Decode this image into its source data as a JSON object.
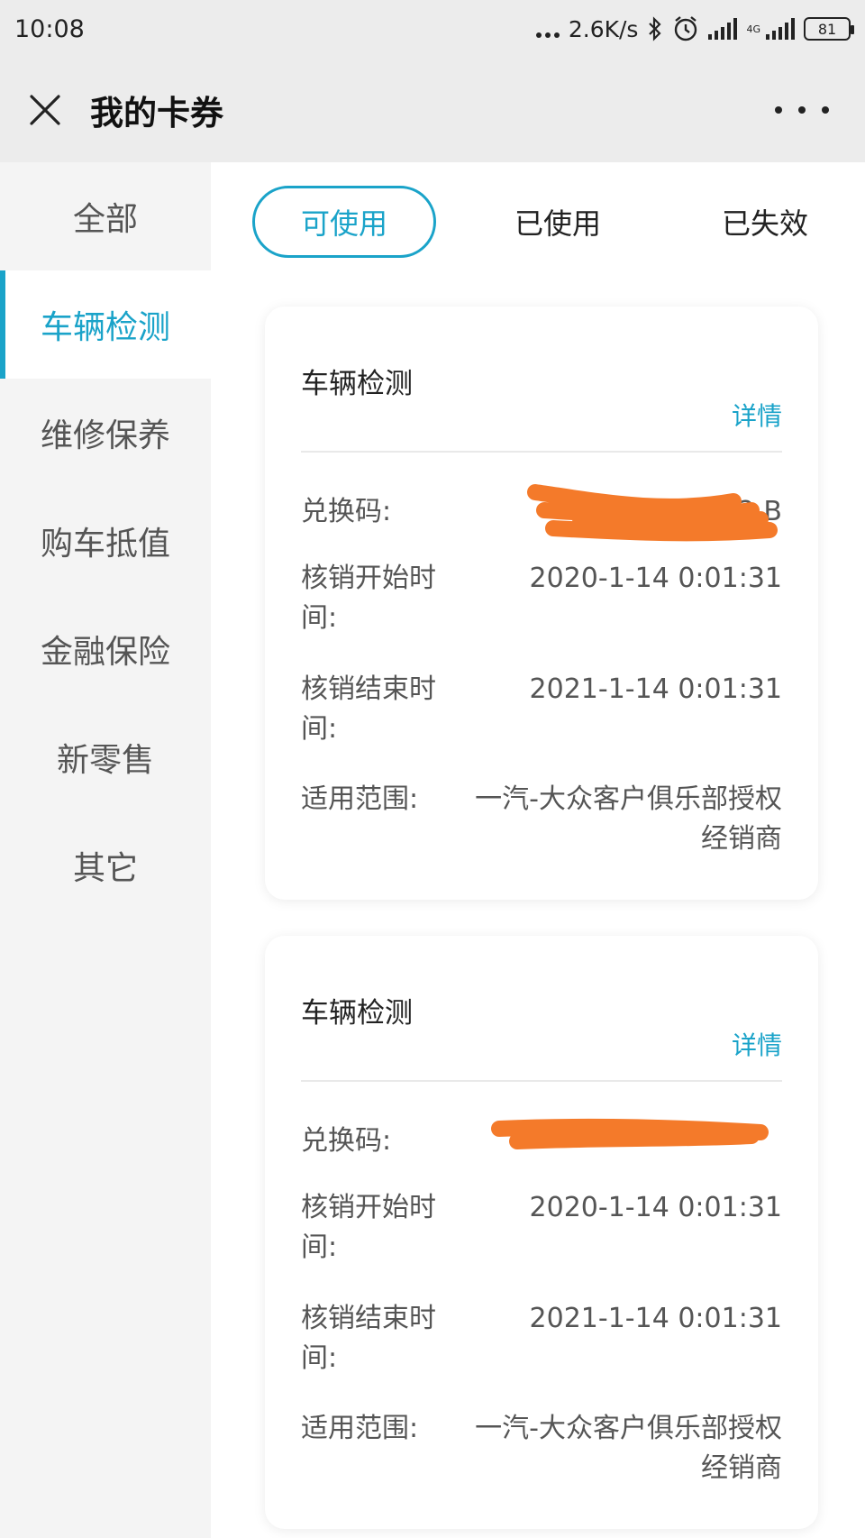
{
  "status_bar": {
    "time": "10:08",
    "net_speed": "2.6K/s",
    "network_type": "4G",
    "battery": "81"
  },
  "header": {
    "title": "我的卡券"
  },
  "sidebar": {
    "items": [
      {
        "label": "全部"
      },
      {
        "label": "车辆检测"
      },
      {
        "label": "维修保养"
      },
      {
        "label": "购车抵值"
      },
      {
        "label": "金融保险"
      },
      {
        "label": "新零售"
      },
      {
        "label": "其它"
      }
    ],
    "active_index": 1
  },
  "tabs": [
    {
      "label": "可使用"
    },
    {
      "label": "已使用"
    },
    {
      "label": "已失效"
    }
  ],
  "cards": [
    {
      "title": "车辆检测",
      "detail_label": "详情",
      "rows": [
        {
          "label": "兑换码:",
          "value": "2 B"
        },
        {
          "label": "核销开始时间:",
          "value": "2020-1-14 0:01:31"
        },
        {
          "label": "核销结束时间:",
          "value": "2021-1-14 0:01:31"
        },
        {
          "label": "适用范围:",
          "value": "一汽-大众客户俱乐部授权经销商"
        }
      ]
    },
    {
      "title": "车辆检测",
      "detail_label": "详情",
      "rows": [
        {
          "label": "兑换码:",
          "value": ""
        },
        {
          "label": "核销开始时间:",
          "value": "2020-1-14 0:01:31"
        },
        {
          "label": "核销结束时间:",
          "value": "2021-1-14 0:01:31"
        },
        {
          "label": "适用范围:",
          "value": "一汽-大众客户俱乐部授权经销商"
        }
      ]
    }
  ],
  "colors": {
    "accent": "#1aa3c9",
    "redaction": "#f47a2a"
  }
}
